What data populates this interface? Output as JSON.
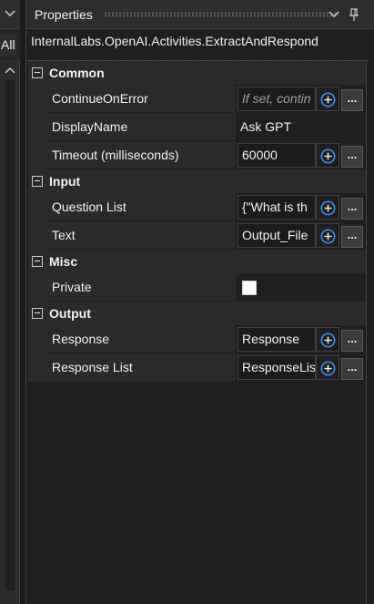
{
  "left_panel": {
    "tab_label": "All",
    "icons": [
      "chevron-down-icon",
      "chevron-up-icon"
    ]
  },
  "panel": {
    "title": "Properties",
    "icons": [
      "dropdown-icon",
      "pin-icon"
    ]
  },
  "type_name": "InternalLabs.OpenAI.Activities.ExtractAndRespond",
  "categories": [
    {
      "label": "Common",
      "properties": [
        {
          "name": "ContinueOnError",
          "value": "If set, contin",
          "placeholder": true,
          "has_buttons": true
        },
        {
          "name": "DisplayName",
          "value": "Ask GPT",
          "placeholder": false,
          "has_buttons": false
        },
        {
          "name": "Timeout (milliseconds)",
          "value": "60000",
          "placeholder": false,
          "has_buttons": true
        }
      ]
    },
    {
      "label": "Input",
      "properties": [
        {
          "name": "Question List",
          "value": "{\"What is th",
          "placeholder": false,
          "has_buttons": true
        },
        {
          "name": "Text",
          "value": "Output_File",
          "placeholder": false,
          "has_buttons": true
        }
      ]
    },
    {
      "label": "Misc",
      "properties": [
        {
          "name": "Private",
          "value": "",
          "checkbox": true,
          "checked": false
        }
      ]
    },
    {
      "label": "Output",
      "properties": [
        {
          "name": "Response",
          "value": "Response",
          "placeholder": false,
          "has_buttons": true
        },
        {
          "name": "Response List",
          "value": "ResponseLis",
          "placeholder": false,
          "has_buttons": true
        }
      ]
    }
  ],
  "ellipsis_label": "...",
  "colors": {
    "background": "#1f1f20",
    "category_bg": "#2a2a2c",
    "plus_icon": "#1e90ff"
  }
}
